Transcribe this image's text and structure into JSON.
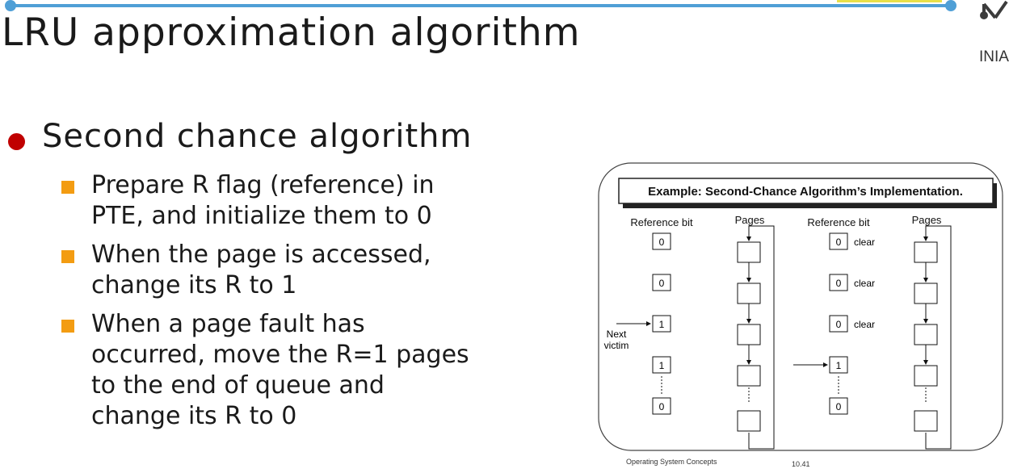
{
  "colors": {
    "accent_line": "#4f9fd6",
    "bullet_primary": "#c00000",
    "bullet_secondary": "#f39c12",
    "logo_dark": "#3c3c3c"
  },
  "header": {
    "title": "LRU approximation algorithm",
    "logo_text": "INIA"
  },
  "content": {
    "bullet": "Second chance algorithm",
    "subitems": [
      {
        "lines": [
          "Prepare R flag (reference) in",
          "PTE, and initialize them to 0"
        ]
      },
      {
        "lines": [
          "When the page is accessed,",
          "change its R to 1"
        ]
      },
      {
        "lines": [
          "When a page fault has",
          "occurred, move the R=1 pages",
          "to the end of queue and",
          "change its R to 0"
        ]
      }
    ]
  },
  "figure": {
    "banner": "Example: Second-Chance Algorithm’s Implementation.",
    "left": {
      "ref_header": "Reference bit",
      "pages_header": "Pages",
      "bits": [
        "0",
        "0",
        "1",
        "1",
        "0"
      ],
      "pointer_label": [
        "Next",
        "victim"
      ]
    },
    "right": {
      "ref_header": "Reference bit",
      "pages_header": "Pages",
      "bits": [
        "0",
        "0",
        "0",
        "1",
        "0"
      ],
      "bit_notes": [
        "clear",
        "clear",
        "clear",
        "",
        ""
      ]
    },
    "footer_left": "Operating System Concepts",
    "footer_right": "10.41"
  }
}
